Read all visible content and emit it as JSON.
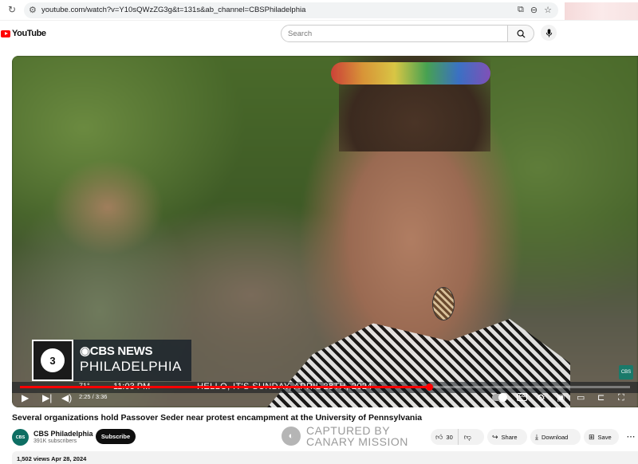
{
  "browser": {
    "url": "youtube.com/watch?v=Y10sQWzZG3g&t=131s&ab_channel=CBSPhiladelphia"
  },
  "header": {
    "logo_text": "YouTube",
    "search_placeholder": "Search"
  },
  "player": {
    "broadcast": {
      "network": "CBS NEWS",
      "station_logo": "3",
      "city": "PHILADELPHIA",
      "temperature": "71°",
      "time": "11:03 PM",
      "ticker": "HELLO, IT'S SUNDAY, APRIL 28TH, 2024"
    },
    "current_time": "2:25",
    "duration": "3:36",
    "time_display": "2:25 / 3:36",
    "progress_fraction": 0.671,
    "accent_color": "#ff0000"
  },
  "video": {
    "title": "Several organizations hold Passover Seder near protest encampment at the University of Pennsylvania",
    "channel_name": "CBS Philadelphia",
    "subscribers": "391K subscribers",
    "subscribe_label": "Subscribe",
    "like_count": "30",
    "share_label": "Share",
    "download_label": "Download",
    "save_label": "Save",
    "views_date": "1,502 views  Apr 28, 2024"
  },
  "watermark": {
    "line1": "CAPTURED BY",
    "line2": "CANARY MISSION"
  }
}
